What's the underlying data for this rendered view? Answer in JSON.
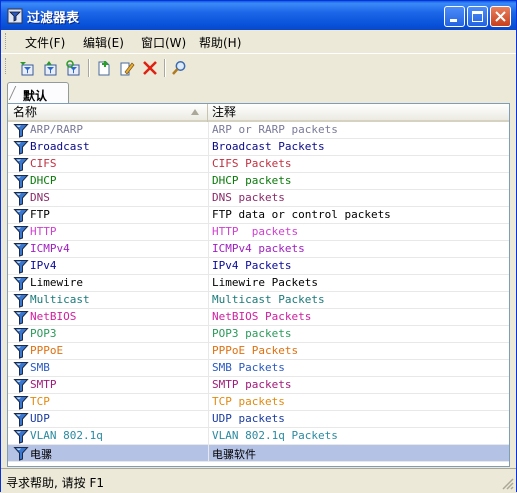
{
  "window": {
    "title": "过滤器表"
  },
  "menu": {
    "items": [
      {
        "label": "文件(F)"
      },
      {
        "label": "编辑(E)"
      },
      {
        "label": "窗口(W)"
      },
      {
        "label": "帮助(H)"
      }
    ]
  },
  "toolbar": {
    "buttons": [
      {
        "icon": "import-filter-icon"
      },
      {
        "icon": "export-filter-icon"
      },
      {
        "icon": "refresh-filters-icon"
      },
      {
        "icon": "new-filter-icon"
      },
      {
        "icon": "edit-filter-icon"
      },
      {
        "icon": "delete-filter-icon"
      },
      {
        "icon": "search-icon"
      }
    ]
  },
  "tabs": [
    {
      "label": "默认"
    }
  ],
  "table": {
    "columns": [
      {
        "label": "名称"
      },
      {
        "label": "注释"
      }
    ],
    "rows": [
      {
        "name": "ARP/RARP",
        "note": "ARP or RARP packets",
        "color": "#7A7A9A"
      },
      {
        "name": "Broadcast",
        "note": "Broadcast Packets",
        "color": "#0A0A8A"
      },
      {
        "name": "CIFS",
        "note": "CIFS Packets",
        "color": "#C03040"
      },
      {
        "name": "DHCP",
        "note": "DHCP packets",
        "color": "#0A7A0A"
      },
      {
        "name": "DNS",
        "note": "DNS packets",
        "color": "#8A2A6A"
      },
      {
        "name": "FTP",
        "note": "FTP data or control packets",
        "color": "#000000"
      },
      {
        "name": "HTTP",
        "note": "HTTP  packets",
        "color": "#D040D0"
      },
      {
        "name": "ICMPv4",
        "note": "ICMPv4 packets",
        "color": "#A020C0"
      },
      {
        "name": "IPv4",
        "note": "IPv4 Packets",
        "color": "#0A0A9A"
      },
      {
        "name": "Limewire",
        "note": "Limewire Packets",
        "color": "#000000"
      },
      {
        "name": "Multicast",
        "note": "Multicast Packets",
        "color": "#1A7A7A"
      },
      {
        "name": "NetBIOS",
        "note": "NetBIOS Packets",
        "color": "#D020A0"
      },
      {
        "name": "POP3",
        "note": "POP3 packets",
        "color": "#2A9A5A"
      },
      {
        "name": "PPPoE",
        "note": "PPPoE Packets",
        "color": "#E07010"
      },
      {
        "name": "SMB",
        "note": "SMB Packets",
        "color": "#2A5AC0"
      },
      {
        "name": "SMTP",
        "note": "SMTP packets",
        "color": "#A01A7A"
      },
      {
        "name": "TCP",
        "note": "TCP packets",
        "color": "#E08A10"
      },
      {
        "name": "UDP",
        "note": "UDP packets",
        "color": "#1A3AA0"
      },
      {
        "name": "VLAN 802.1q",
        "note": "VLAN 802.1q Packets",
        "color": "#2A8AA0"
      },
      {
        "name": "电骡",
        "note": "电骡软件",
        "color": "#000000",
        "selected": true
      }
    ]
  },
  "status": {
    "text": "寻求帮助, 请按 F1"
  },
  "colors": {
    "title_bar": "#0A5FE8",
    "selected_row": "#B4C2E6",
    "window_bg": "#ECE9D8"
  }
}
